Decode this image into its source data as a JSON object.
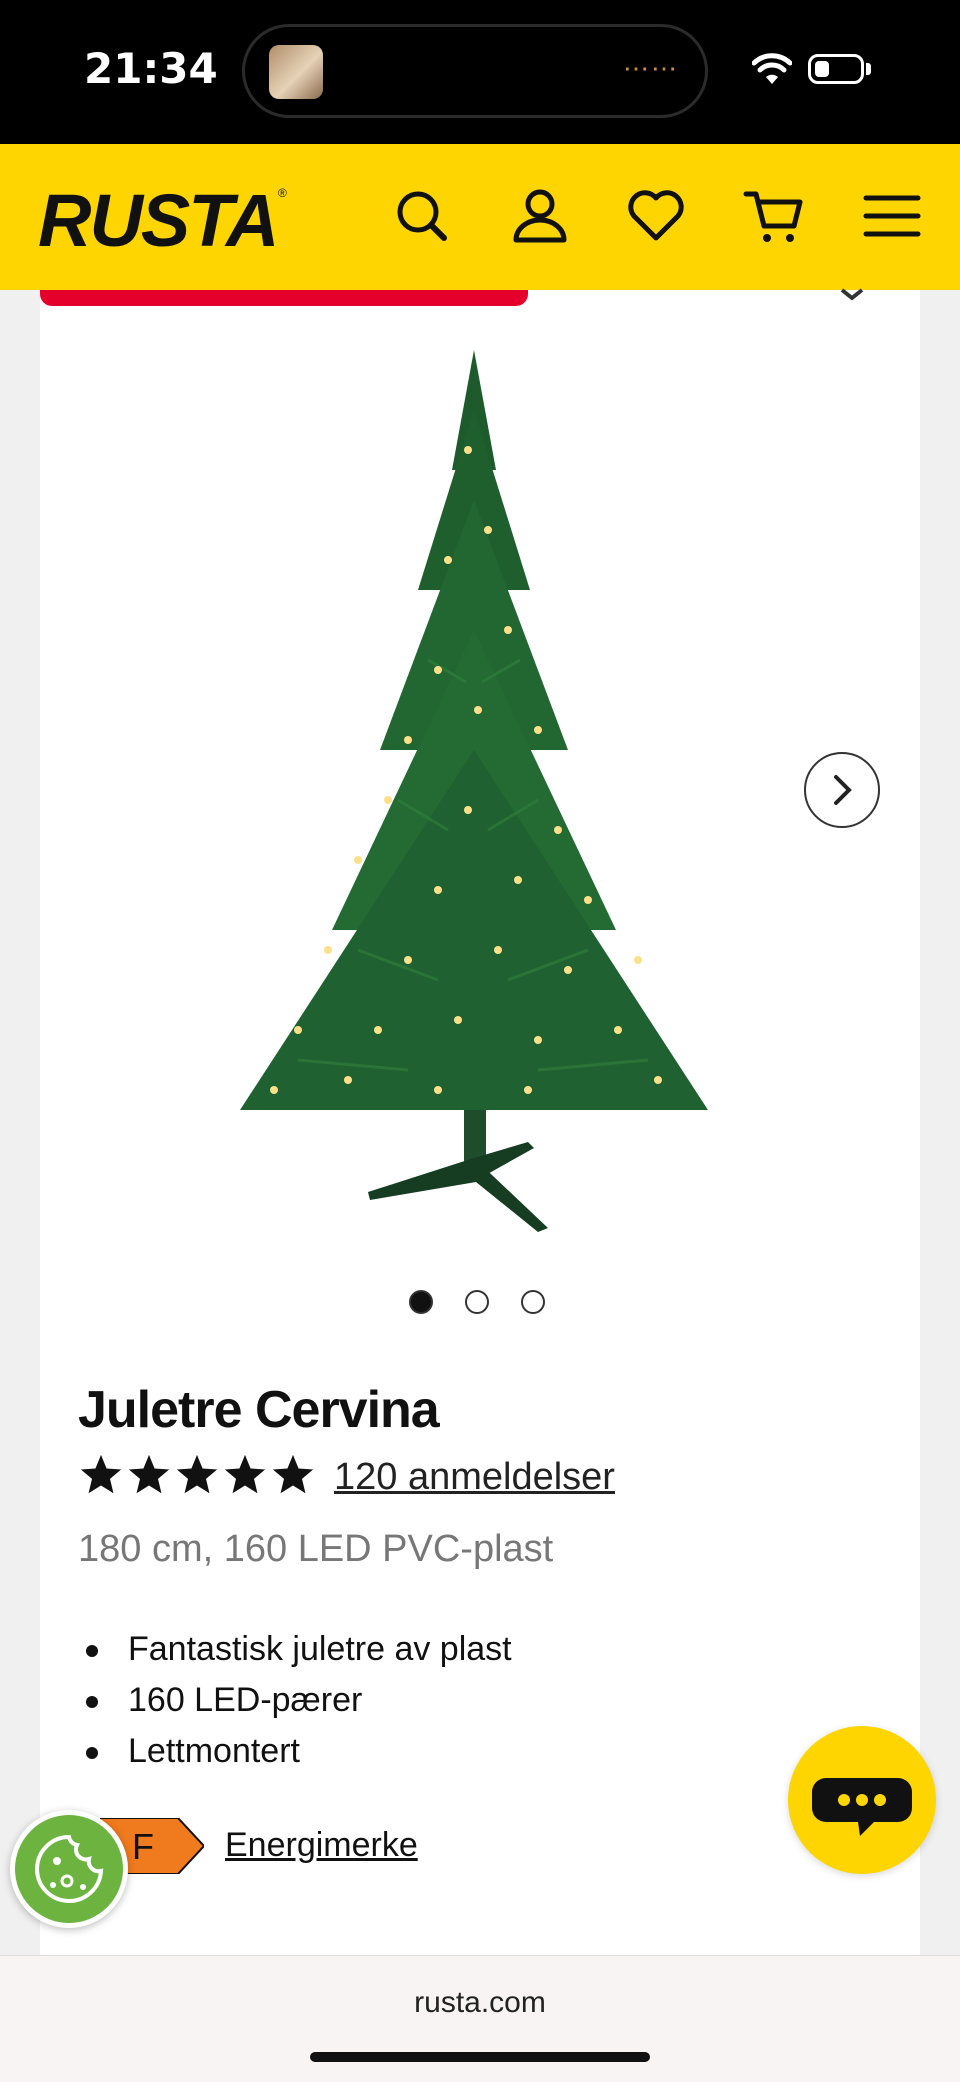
{
  "status_bar": {
    "time": "21:34"
  },
  "header": {
    "logo": "RUSTA",
    "icons": [
      "search-icon",
      "account-icon",
      "heart-icon",
      "cart-icon",
      "menu-icon"
    ],
    "background_color": "#ffd500"
  },
  "product": {
    "image_count": 3,
    "active_image_index": 0,
    "title": "Juletre Cervina",
    "rating_stars": 5,
    "reviews_link": "120 anmeldelser",
    "subtitle": "180 cm, 160 LED PVC-plast",
    "features": [
      "Fantastisk juletre av plast",
      "160 LED-pærer",
      "Lettmontert"
    ],
    "energy_class": "F",
    "energy_link": "Energimerke",
    "energy_color": "#f07a1e",
    "sale_color": "#e4002b"
  },
  "browser": {
    "url": "rusta.com"
  }
}
